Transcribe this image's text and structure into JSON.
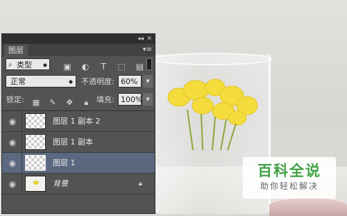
{
  "panel": {
    "tab_label": "图层",
    "collapse_icon": "double-chevron-icon",
    "close_icon": "close-icon",
    "menu_icon": "panel-menu-icon"
  },
  "filter": {
    "kind_label": "类型",
    "icons": [
      "image-filter-icon",
      "adjustment-filter-icon",
      "type-filter-icon",
      "shape-filter-icon",
      "smart-object-filter-icon"
    ]
  },
  "blend": {
    "mode": "正常",
    "opacity_label": "不透明度:",
    "opacity_value": "60%"
  },
  "lock": {
    "label": "锁定:",
    "icons": [
      "lock-transparent-icon",
      "lock-image-icon",
      "lock-position-icon",
      "lock-all-icon"
    ],
    "fill_label": "填充:",
    "fill_value": "100%"
  },
  "layers": [
    {
      "name": "图层 1 副本 2",
      "selected": false
    },
    {
      "name": "图层 1 副本",
      "selected": false
    },
    {
      "name": "图层 1",
      "selected": true
    },
    {
      "name": "背景",
      "selected": false,
      "locked": true
    }
  ],
  "watermark": {
    "main": "百科全说",
    "sub": "助你轻松解决"
  }
}
